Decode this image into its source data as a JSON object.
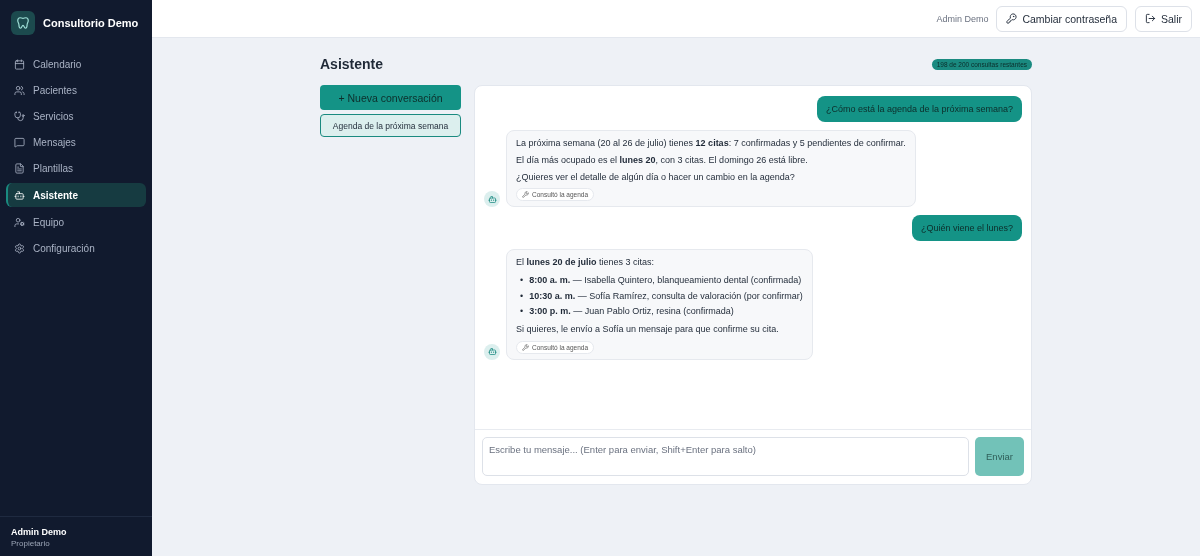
{
  "sidebar": {
    "brand": "Consultorio Demo",
    "items": [
      {
        "label": "Calendario",
        "selected": false
      },
      {
        "label": "Pacientes",
        "selected": false
      },
      {
        "label": "Servicios",
        "selected": false
      },
      {
        "label": "Mensajes",
        "selected": false
      },
      {
        "label": "Plantillas",
        "selected": false
      },
      {
        "label": "Asistente",
        "selected": true
      },
      {
        "label": "Equipo",
        "selected": false
      },
      {
        "label": "Configuración",
        "selected": false
      }
    ],
    "user": {
      "name": "Admin Demo",
      "role": "Propietario"
    }
  },
  "header": {
    "user": "Admin Demo",
    "buttons": [
      "Cambiar contraseña",
      "Salir"
    ]
  },
  "page": {
    "title": "Asistente",
    "quota": "198 de 200 consultas restantes"
  },
  "new_conversation": "+ Nueva conversación",
  "conversations": [
    {
      "label": "Agenda de la próxima semana",
      "selected": true
    }
  ],
  "messages": [
    {
      "kind": "user",
      "text": "¿Cómo está la agenda de la próxima semana?"
    },
    {
      "kind": "assistant",
      "blocks": [
        {
          "kind": "paragraph",
          "text": "La próxima semana (20 al 26 de julio) tienes **12 citas**: 7 confirmadas y 5 pendientes de confirmar."
        },
        {
          "kind": "paragraph",
          "text": "El día más ocupado es el **lunes 20**, con 3 citas. El domingo 26 está libre."
        },
        {
          "kind": "paragraph",
          "text": "¿Quieres ver el detalle de algún día o hacer un cambio en la agenda?"
        }
      ],
      "tool": "Consultó la agenda"
    },
    {
      "kind": "user",
      "text": "¿Quién viene el lunes?"
    },
    {
      "kind": "assistant",
      "blocks": [
        {
          "kind": "paragraph",
          "text": "El **lunes 20 de julio** tienes 3 citas:"
        },
        {
          "kind": "list",
          "marker": "•",
          "items": [
            "**8:00 a. m.** — Isabella Quintero, blanqueamiento dental (confirmada)",
            "**10:30 a. m.** — Sofía Ramírez, consulta de valoración (por confirmar)",
            "**3:00 p. m.** — Juan Pablo Ortiz, resina (confirmada)"
          ]
        },
        {
          "kind": "paragraph",
          "text": "Si quieres, le envío a Sofía un mensaje para que confirme su cita."
        }
      ],
      "tool": "Consultó la agenda"
    }
  ],
  "composer": {
    "placeholder": "Escribe tu mensaje... (Enter para enviar, Shift+Enter para salto)",
    "send": "Enviar",
    "send_disabled": true
  }
}
